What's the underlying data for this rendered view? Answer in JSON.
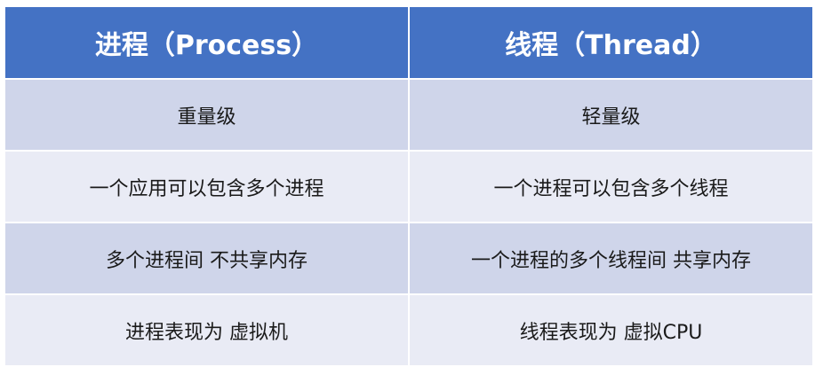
{
  "table": {
    "headers": [
      "进程（Process）",
      "线程（Thread）"
    ],
    "rows": [
      [
        "重量级",
        "轻量级"
      ],
      [
        "一个应用可以包含多个进程",
        "一个进程可以包含多个线程"
      ],
      [
        "多个进程间 不共享内存",
        "一个进程的多个线程间 共享内存"
      ],
      [
        "进程表现为 虚拟机",
        "线程表现为 虚拟CPU"
      ]
    ]
  },
  "colors": {
    "header_bg": "#4472c4",
    "header_text": "#ffffff",
    "row_band_dark": "#cfd5ea",
    "row_band_light": "#e9ebf5"
  }
}
